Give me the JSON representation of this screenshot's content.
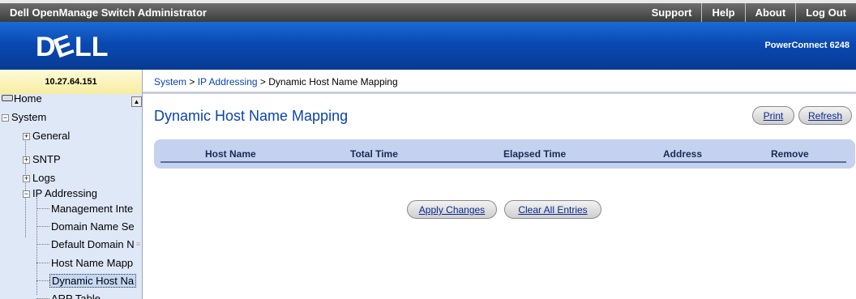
{
  "topbar": {
    "title": "Dell OpenManage Switch Administrator",
    "links": [
      "Support",
      "Help",
      "About",
      "Log Out"
    ]
  },
  "banner": {
    "logo_text": "DELL",
    "product": "PowerConnect 6248"
  },
  "device": {
    "ip": "10.27.64.151"
  },
  "breadcrumb": {
    "items": [
      "System",
      "IP Addressing",
      "Dynamic Host Name Mapping"
    ],
    "separator": ">"
  },
  "sidebar": {
    "items": [
      {
        "label": "Home",
        "level": 0
      },
      {
        "label": "System",
        "level": 0,
        "toggle": "−"
      },
      {
        "label": "General",
        "level": 1,
        "toggle": "+"
      },
      {
        "label": "SNTP",
        "level": 1,
        "toggle": "+"
      },
      {
        "label": "Logs",
        "level": 1,
        "toggle": "+"
      },
      {
        "label": "IP Addressing",
        "level": 1,
        "toggle": "−"
      },
      {
        "label": "Management Inte",
        "level": 2
      },
      {
        "label": "Domain Name Se",
        "level": 2
      },
      {
        "label": "Default Domain N",
        "level": 2
      },
      {
        "label": "Host Name Mapp",
        "level": 2
      },
      {
        "label": "Dynamic Host Na",
        "level": 2,
        "selected": true
      },
      {
        "label": "ARP Table",
        "level": 2
      }
    ],
    "scroll_up": "▲"
  },
  "main": {
    "title": "Dynamic Host Name Mapping",
    "print_label": "Print",
    "refresh_label": "Refresh",
    "columns": [
      "Host Name",
      "Total Time",
      "Elapsed Time",
      "Address",
      "Remove"
    ],
    "rows": [],
    "apply_label": "Apply Changes",
    "clear_label": "Clear All Entries"
  },
  "colors": {
    "banner_blue": "#0a49b2",
    "link_blue": "#0a43b5",
    "header_band": "#c4d2ef",
    "sidebar_bg": "#dfe8f7"
  }
}
